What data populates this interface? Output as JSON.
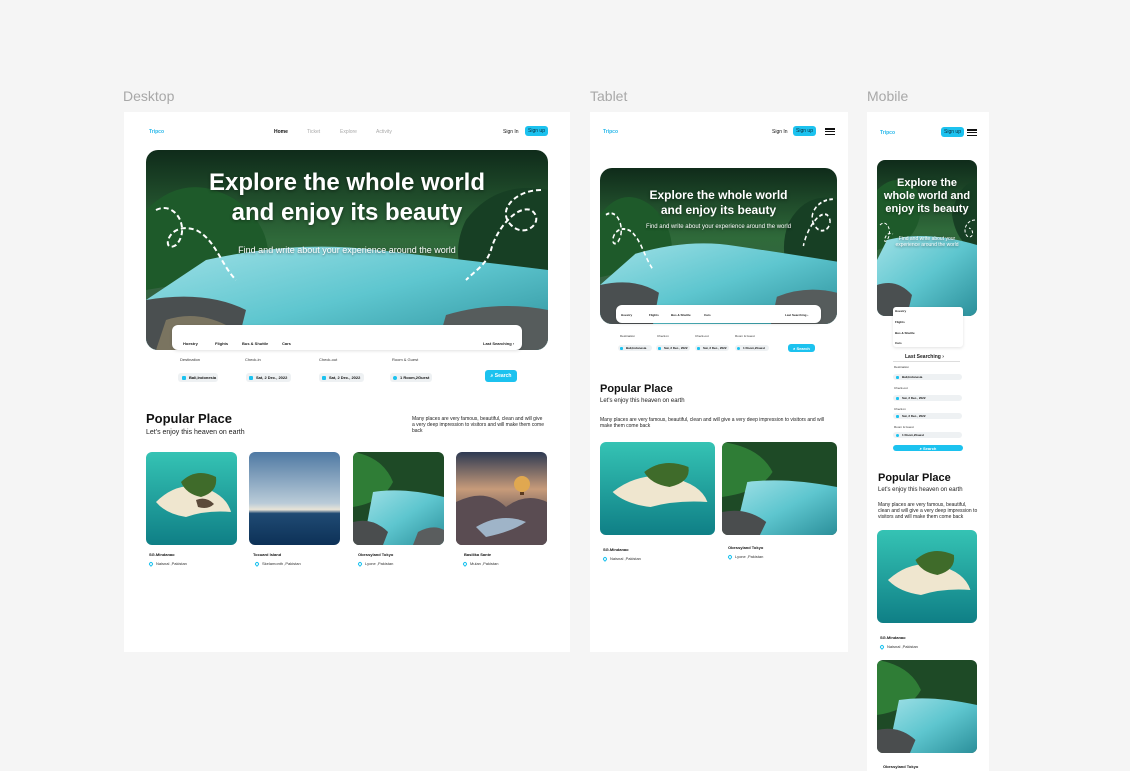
{
  "labels": {
    "desktop": "Desktop",
    "tablet": "Tablet",
    "mobile": "Mobile"
  },
  "brand": "Tripco",
  "nav": {
    "home": "Home",
    "ticket": "Ticket",
    "explore": "Explore",
    "activity": "Activity"
  },
  "auth": {
    "signin": "Sign In",
    "signin_short": "Sign In",
    "signup": "Sign up"
  },
  "hero": {
    "title_line1": "Explore the whole world",
    "title_line2": "and enjoy its beauty",
    "mobile_title": "Explore the whole world and enjoy its beauty",
    "subtitle": "Find and write about your experience around the world",
    "mobile_subtitle": "Find and write about your experience around the world"
  },
  "search": {
    "tabs": [
      "Hoestry",
      "Flights",
      "Bus & Shuttle",
      "Cars"
    ],
    "last_searching": "Last Searching",
    "fields": {
      "destination_label": "Destination",
      "checkin_label": "Check-in",
      "checkout_label": "Check-out",
      "room_label": "Room & Guest",
      "destination_value": "Bali,Indonesia",
      "checkin_value": "Sat, 2 Dec., 2022",
      "checkout_value": "Sat, 2 Dec., 2022",
      "room_value": "1 Room,2Guest"
    },
    "button": "Search",
    "mobile_fields": {
      "destination_label": "Destination",
      "checkin_label": "Check-out",
      "checkout_label": "Check-in",
      "room_label": "Room & Guest",
      "destination_value": "Bali,Indonesia",
      "checkin_value": "Sat, 2 Dec., 2022",
      "checkout_value": "Sat, 2 Dec., 2022",
      "room_value": "1 Room,2Guest"
    }
  },
  "popular": {
    "title": "Popular Place",
    "subtitle": "Let's enjoy this heaven on earth",
    "description": "Many places are very famous, beautiful, clean and will give a very deep impression to visitors and will make them come back",
    "places": [
      {
        "name": "SG.Mindanao",
        "location": "Naisnal ,Pakistan"
      },
      {
        "name": "Tocuard Island",
        "location": "Skelamonth ,Pakistan"
      },
      {
        "name": "Obessyland Tokyo",
        "location": "Lyone ,Pakistan"
      },
      {
        "name": "Basilika Sante",
        "location": "Mulan ,Pakistan"
      }
    ]
  },
  "colors": {
    "accent": "#1cc2ef",
    "brand": "#29b8ea"
  }
}
